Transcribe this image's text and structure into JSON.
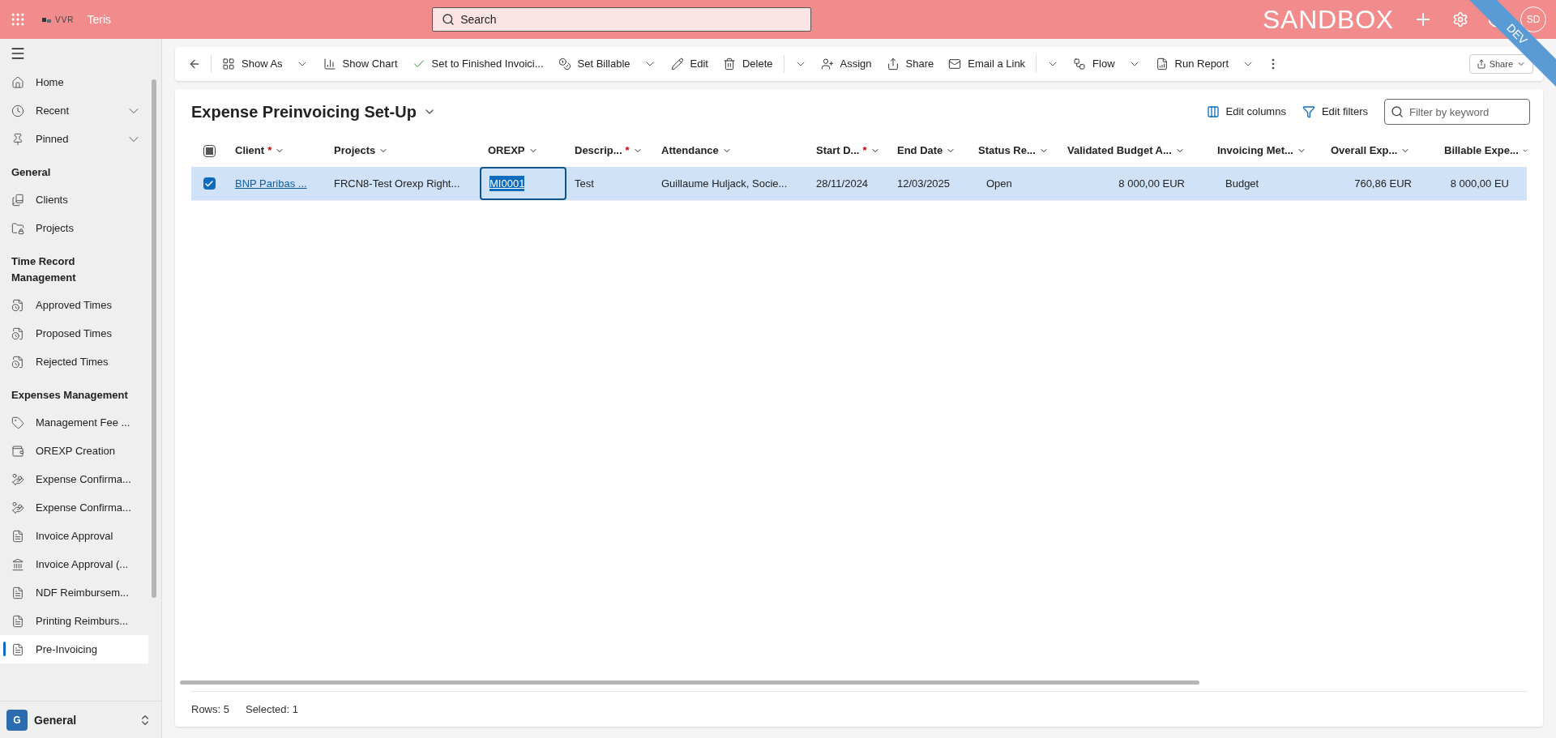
{
  "topbar": {
    "logo_text": "VVR",
    "app_name": "Teris",
    "search": {
      "placeholder": "Search"
    },
    "environment": "SANDBOX",
    "avatar": "SD",
    "ribbon": "DEV"
  },
  "sidebar": {
    "groups": [
      {
        "items": [
          {
            "label": "Home",
            "selected": false,
            "expandable": false
          },
          {
            "label": "Recent",
            "selected": false,
            "expandable": true
          },
          {
            "label": "Pinned",
            "selected": false,
            "expandable": true
          }
        ]
      },
      {
        "title": "General",
        "items": [
          {
            "label": "Clients",
            "selected": false,
            "expandable": false
          },
          {
            "label": "Projects",
            "selected": false,
            "expandable": false
          }
        ]
      },
      {
        "title": "Time Record Management",
        "items": [
          {
            "label": "Approved Times",
            "selected": false,
            "expandable": false
          },
          {
            "label": "Proposed Times",
            "selected": false,
            "expandable": false
          },
          {
            "label": "Rejected Times",
            "selected": false,
            "expandable": false
          }
        ]
      },
      {
        "title": "Expenses Management",
        "items": [
          {
            "label": "Management Fee ...",
            "selected": false,
            "expandable": false
          },
          {
            "label": "OREXP Creation",
            "selected": false,
            "expandable": false
          },
          {
            "label": "Expense Confirma...",
            "selected": false,
            "expandable": false
          },
          {
            "label": "Expense Confirma...",
            "selected": false,
            "expandable": false
          },
          {
            "label": "Invoice Approval",
            "selected": false,
            "expandable": false
          },
          {
            "label": "Invoice Approval (...",
            "selected": false,
            "expandable": false
          },
          {
            "label": "NDF Reimbursem...",
            "selected": false,
            "expandable": false
          },
          {
            "label": "Printing Reimburs...",
            "selected": false,
            "expandable": false
          },
          {
            "label": "Pre-Invoicing",
            "selected": true,
            "expandable": false
          }
        ]
      }
    ],
    "area": {
      "badge": "G",
      "label": "General"
    }
  },
  "commandbar": {
    "items": [
      {
        "kind": "button",
        "label": "Show As",
        "dropdown": true
      },
      {
        "kind": "button",
        "label": "Show Chart",
        "dropdown": false
      },
      {
        "kind": "button",
        "label": "Set to Finished Invoici...",
        "dropdown": false
      },
      {
        "kind": "button",
        "label": "Set Billable",
        "dropdown": true
      },
      {
        "kind": "button",
        "label": "Edit",
        "dropdown": false
      },
      {
        "kind": "button",
        "label": "Delete",
        "dropdown": false
      },
      {
        "kind": "split"
      },
      {
        "kind": "button",
        "label": "Assign",
        "dropdown": false
      },
      {
        "kind": "button",
        "label": "Share",
        "dropdown": false
      },
      {
        "kind": "button",
        "label": "Email a Link",
        "dropdown": false
      },
      {
        "kind": "split"
      },
      {
        "kind": "button",
        "label": "Flow",
        "dropdown": true
      },
      {
        "kind": "button",
        "label": "Run Report",
        "dropdown": true
      },
      {
        "kind": "more"
      }
    ],
    "share_button": "Share"
  },
  "view": {
    "title": "Expense Preinvoicing Set-Up",
    "edit_columns": "Edit columns",
    "edit_filters": "Edit filters",
    "filter": {
      "placeholder": "Filter by keyword"
    }
  },
  "table": {
    "all_selected": false,
    "columns": [
      {
        "label": "Client",
        "required_mark": "*"
      },
      {
        "label": "Projects"
      },
      {
        "label": "OREXP"
      },
      {
        "label": "Descrip...",
        "required_mark": "*"
      },
      {
        "label": "Attendance"
      },
      {
        "label": "Start D...",
        "required_mark": "*"
      },
      {
        "label": "End Date"
      },
      {
        "label": "Status Re..."
      },
      {
        "label": "Validated Budget A..."
      },
      {
        "label": "Invoicing Met..."
      },
      {
        "label": "Overall Exp..."
      },
      {
        "label": "Billable Expe..."
      }
    ],
    "rows": [
      {
        "selected": true,
        "cells": [
          {
            "text": "BNP Paribas ...",
            "kind": "link"
          },
          {
            "text": "FRCN8-Test Orexp Right...",
            "kind": "text"
          },
          {
            "text": "MI0001",
            "kind": "focused"
          },
          {
            "text": "Test",
            "kind": "text"
          },
          {
            "text": "Guillaume Huljack, Socie...",
            "kind": "text"
          },
          {
            "text": "28/11/2024",
            "kind": "text"
          },
          {
            "text": "12/03/2025",
            "kind": "text"
          },
          {
            "text": "Open",
            "kind": "text"
          },
          {
            "text": "8 000,00 EUR",
            "kind": "text"
          },
          {
            "text": "Budget",
            "kind": "text"
          },
          {
            "text": "760,86 EUR",
            "kind": "text"
          },
          {
            "text": "8 000,00 EU",
            "kind": "text"
          }
        ]
      }
    ]
  },
  "footer": {
    "rows": "Rows: 5",
    "selected": "Selected: 1"
  }
}
